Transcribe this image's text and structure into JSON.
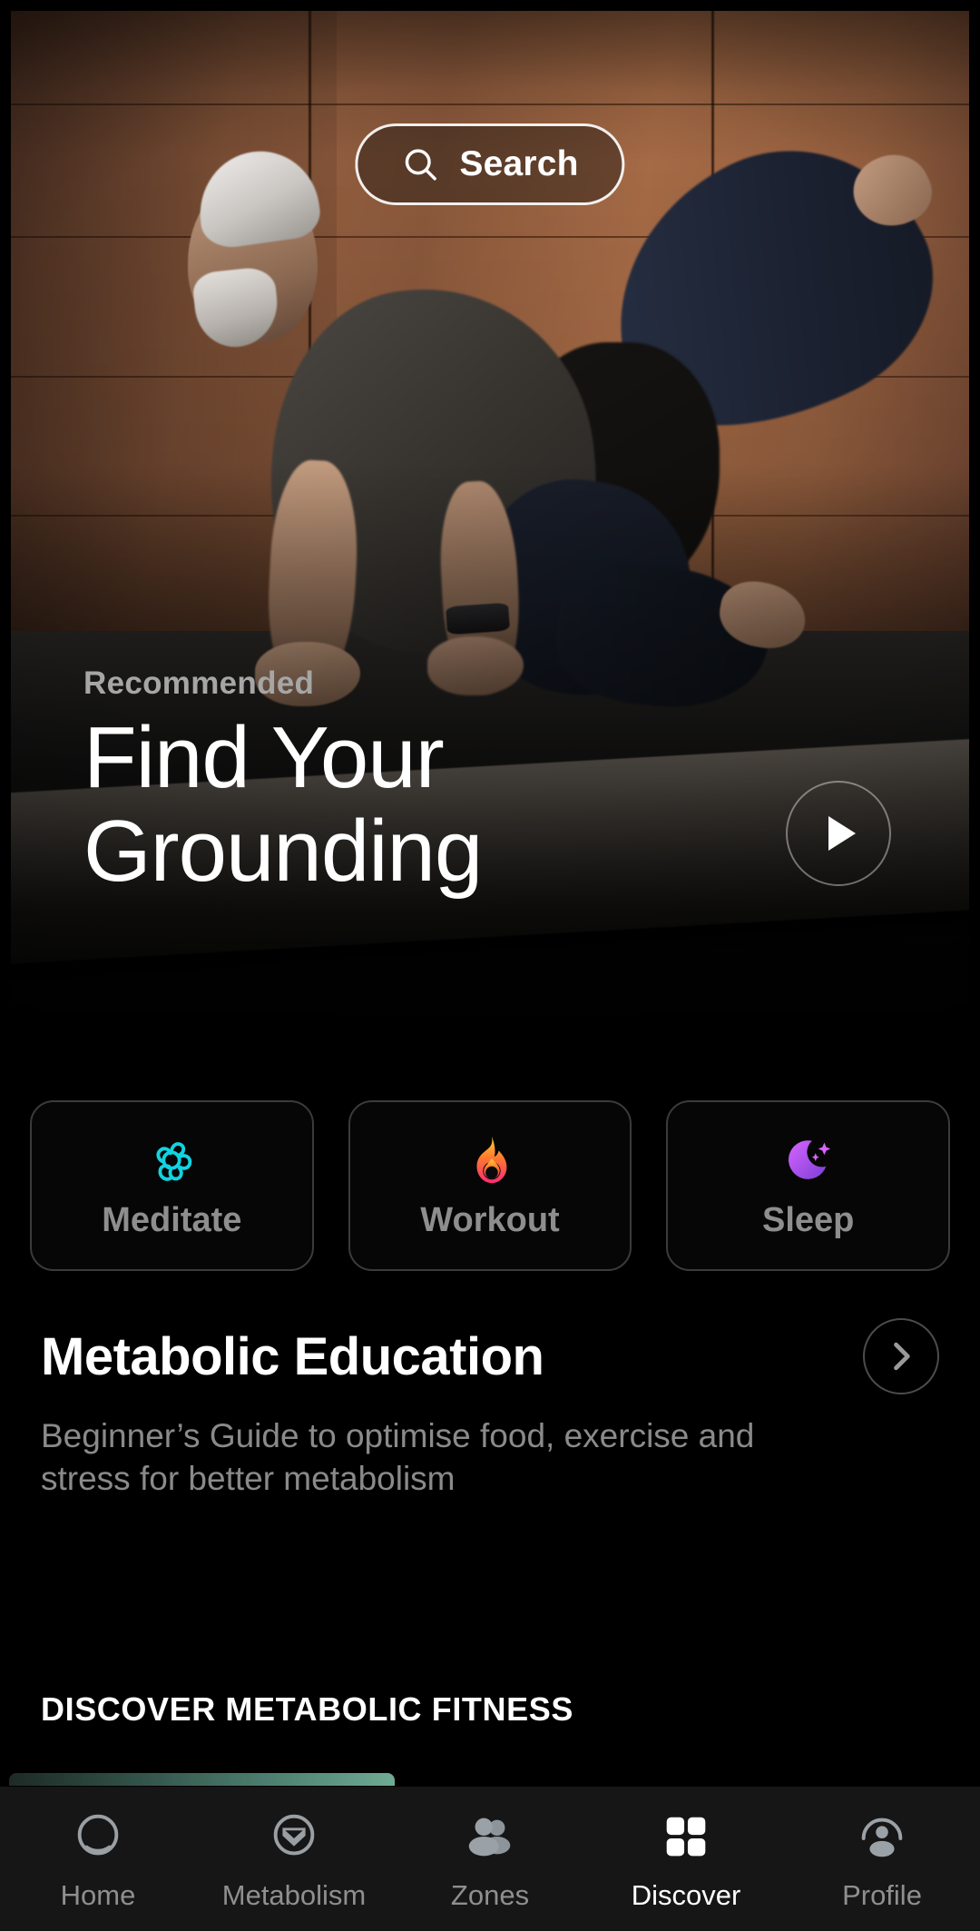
{
  "search": {
    "label": "Search",
    "icon": "search-icon"
  },
  "hero": {
    "kicker": "Recommended",
    "title_line1": "Find Your",
    "title_line2": "Grounding",
    "play_icon": "play-icon"
  },
  "categories": [
    {
      "label": "Meditate",
      "icon": "lotus-icon",
      "color": "#12d3e0"
    },
    {
      "label": "Workout",
      "icon": "flame-icon",
      "color": "#fb4b6b"
    },
    {
      "label": "Sleep",
      "icon": "moon-icon",
      "color": "#b44bf0"
    }
  ],
  "education": {
    "title": "Metabolic Education",
    "subtitle": "Beginner’s Guide to optimise food, exercise and stress for better metabolism",
    "arrow_icon": "chevron-right-icon"
  },
  "discover": {
    "section_header": "DISCOVER METABOLIC FITNESS"
  },
  "nav": {
    "items": [
      {
        "label": "Home",
        "icon": "home-circle-icon",
        "active": false
      },
      {
        "label": "Metabolism",
        "icon": "metabolism-icon",
        "active": false
      },
      {
        "label": "Zones",
        "icon": "people-icon",
        "active": false
      },
      {
        "label": "Discover",
        "icon": "grid-squares-icon",
        "active": true
      },
      {
        "label": "Profile",
        "icon": "person-circle-icon",
        "active": false
      }
    ]
  },
  "theme": {
    "background": "#000000",
    "nav_background": "#161616",
    "accent_teal": "#6fab95",
    "muted_text": "#8a8a8a"
  }
}
